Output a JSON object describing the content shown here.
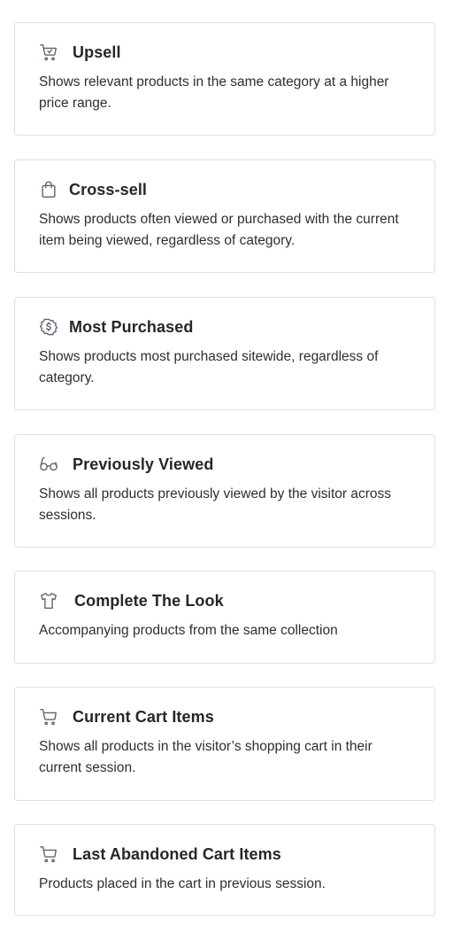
{
  "strategies": [
    {
      "icon": "cart-icon",
      "title": "Upsell",
      "description": "Shows relevant products in the same category at a higher price range."
    },
    {
      "icon": "shopping-bag-icon",
      "title": "Cross-sell",
      "description": "Shows products often viewed or purchased with the current item being viewed, regardless of category."
    },
    {
      "icon": "dollar-badge-icon",
      "title": "Most Purchased",
      "description": "Shows products most purchased sitewide, regardless of category."
    },
    {
      "icon": "eyeglasses-icon",
      "title": "Previously Viewed",
      "description": "Shows all products previously viewed by the visitor across sessions."
    },
    {
      "icon": "tshirt-icon",
      "title": "Complete The Look",
      "description": "Accompanying products from the same collection"
    },
    {
      "icon": "cart-icon",
      "title": "Current Cart Items",
      "description": "Shows all products in the visitor’s shopping cart in their current session."
    },
    {
      "icon": "cart-icon",
      "title": "Last Abandoned Cart Items",
      "description": "Products placed in the cart in previous session."
    }
  ],
  "colors": {
    "border": "#dcdfe3",
    "icon": "#5b6470",
    "title": "#23272b",
    "text": "#2b2f33"
  }
}
